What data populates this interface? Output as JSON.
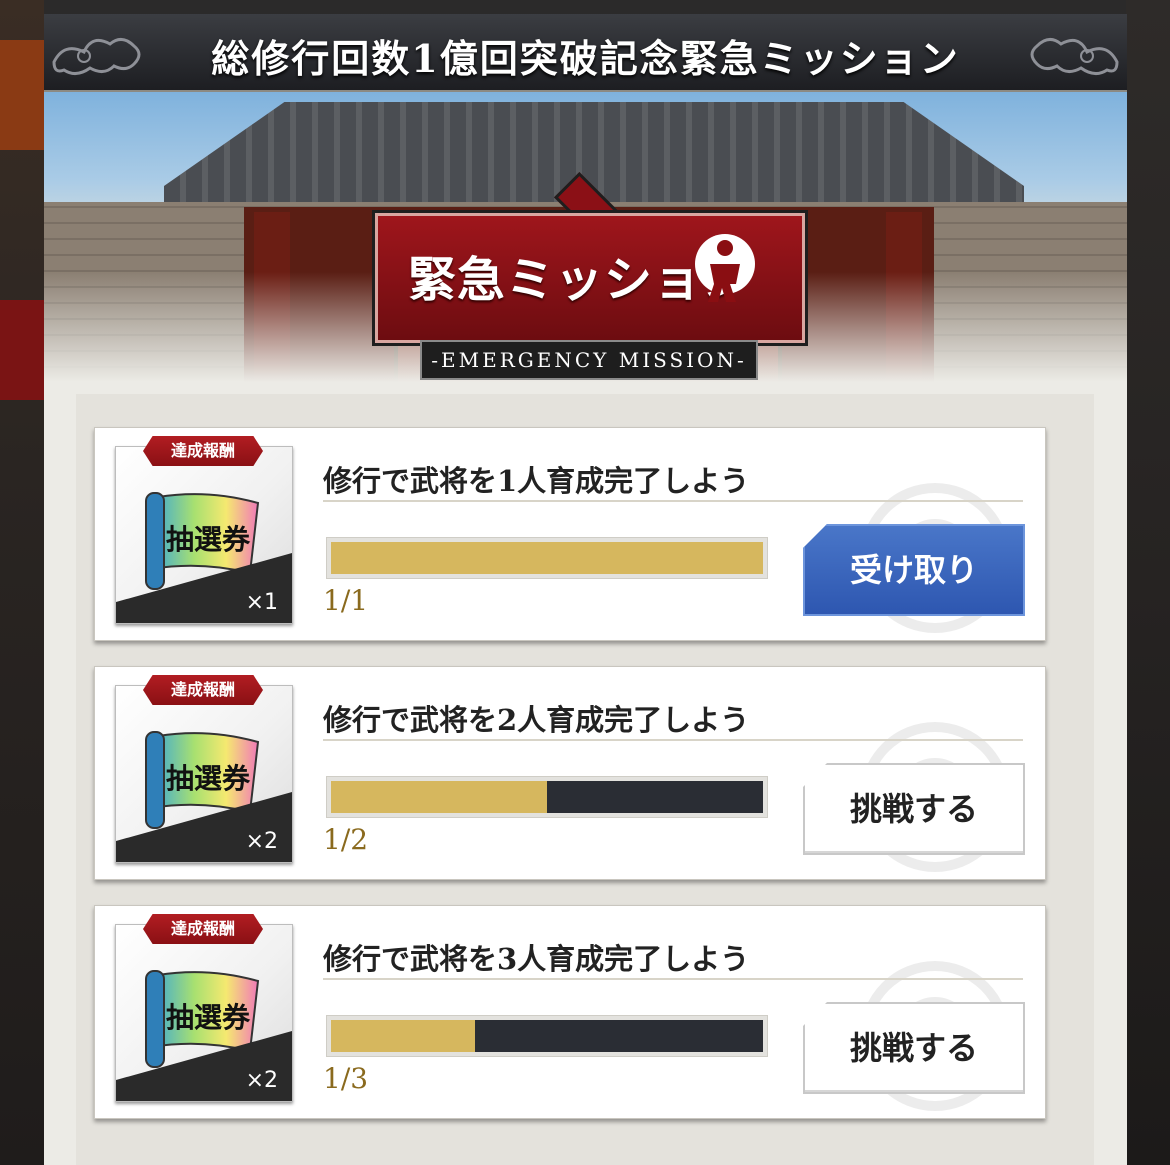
{
  "modal": {
    "title": "総修行回数1億回突破記念緊急ミッション"
  },
  "banner": {
    "title_jp": "緊急ミッション",
    "subtitle_en": "-EMERGENCY MISSION-"
  },
  "missions": [
    {
      "reward_tag": "達成報酬",
      "reward_item_text": "抽選券",
      "reward_count": "×1",
      "title": "修行で武将を1人育成完了しよう",
      "progress_text": "1/1",
      "progress_fraction": 1.0,
      "button_label": "受け取り",
      "button_kind": "claim"
    },
    {
      "reward_tag": "達成報酬",
      "reward_item_text": "抽選券",
      "reward_count": "×2",
      "title": "修行で武将を2人育成完了しよう",
      "progress_text": "1/2",
      "progress_fraction": 0.5,
      "button_label": "挑戦する",
      "button_kind": "challenge"
    },
    {
      "reward_tag": "達成報酬",
      "reward_item_text": "抽選券",
      "reward_count": "×2",
      "title": "修行で武将を3人育成完了しよう",
      "progress_text": "1/3",
      "progress_fraction": 0.333,
      "button_label": "挑戦する",
      "button_kind": "challenge"
    }
  ],
  "colors": {
    "progress_fill": "#d6b75e",
    "progress_track": "#2a2d34",
    "claim_button": "#2d56b0",
    "reward_tag": "#b21d22"
  }
}
